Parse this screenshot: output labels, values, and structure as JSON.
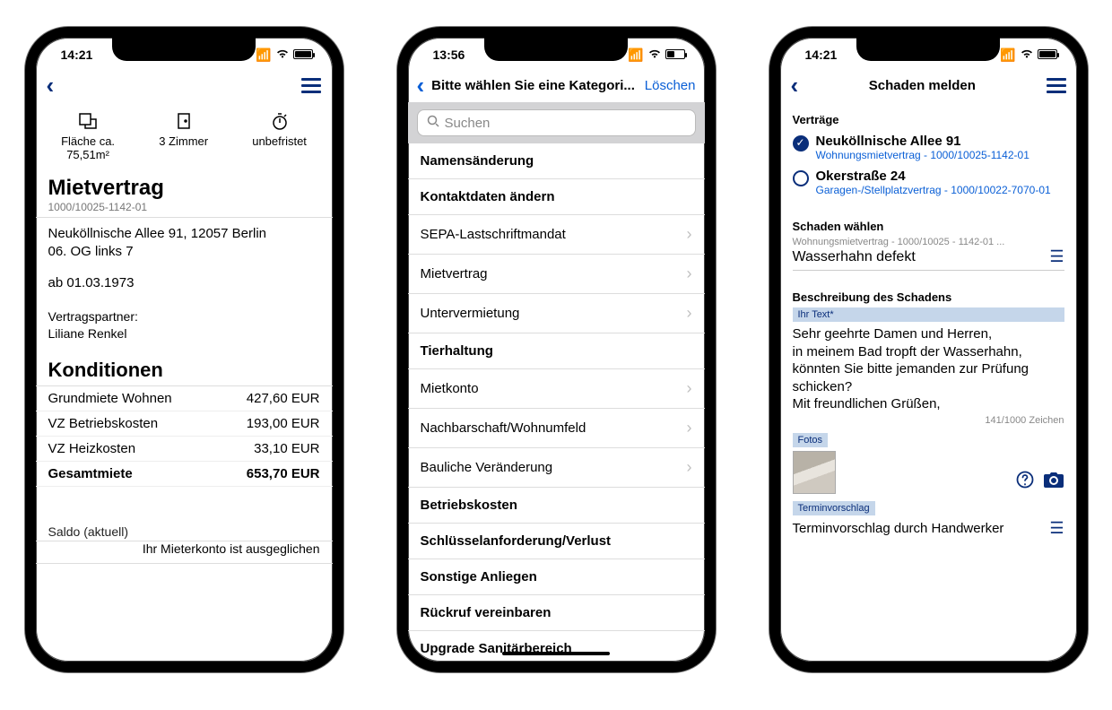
{
  "phone1": {
    "time": "14:21",
    "metrics": {
      "area_label": "Fläche ca.",
      "area_value": "75,51m²",
      "rooms_label": "3 Zimmer",
      "term_label": "unbefristet"
    },
    "title": "Mietvertrag",
    "contract_id": "1000/10025-1142-01",
    "address_line1": "Neuköllnische Allee 91, 12057 Berlin",
    "address_line2": "06. OG links 7",
    "start_date": "ab 01.03.1973",
    "partner_label": "Vertragspartner:",
    "partner_name": "Liliane Renkel",
    "conditions_title": "Konditionen",
    "cond": [
      {
        "label": "Grundmiete Wohnen",
        "value": "427,60 EUR"
      },
      {
        "label": "VZ Betriebskosten",
        "value": "193,00 EUR"
      },
      {
        "label": "VZ Heizkosten",
        "value": "33,10 EUR"
      },
      {
        "label": "Gesamtmiete",
        "value": "653,70 EUR"
      }
    ],
    "saldo_label": "Saldo (aktuell)",
    "saldo_msg": "Ihr Mieterkonto ist ausgeglichen"
  },
  "phone2": {
    "time": "13:56",
    "nav_title": "Bitte wählen Sie eine Kategori...",
    "delete": "Löschen",
    "search_placeholder": "Suchen",
    "categories": [
      {
        "label": "Namensänderung",
        "bold": true,
        "chev": false
      },
      {
        "label": "Kontaktdaten ändern",
        "bold": true,
        "chev": false
      },
      {
        "label": "SEPA-Lastschriftmandat",
        "bold": false,
        "chev": true
      },
      {
        "label": "Mietvertrag",
        "bold": false,
        "chev": true
      },
      {
        "label": "Untervermietung",
        "bold": false,
        "chev": true
      },
      {
        "label": "Tierhaltung",
        "bold": true,
        "chev": false
      },
      {
        "label": "Mietkonto",
        "bold": false,
        "chev": true
      },
      {
        "label": "Nachbarschaft/Wohnumfeld",
        "bold": false,
        "chev": true
      },
      {
        "label": "Bauliche Veränderung",
        "bold": false,
        "chev": true
      },
      {
        "label": "Betriebskosten",
        "bold": true,
        "chev": false
      },
      {
        "label": "Schlüsselanforderung/Verlust",
        "bold": true,
        "chev": false
      },
      {
        "label": "Sonstige Anliegen",
        "bold": true,
        "chev": false
      },
      {
        "label": "Rückruf vereinbaren",
        "bold": true,
        "chev": false
      },
      {
        "label": "Upgrade Sanitärbereich",
        "bold": true,
        "chev": false
      }
    ]
  },
  "phone3": {
    "time": "14:21",
    "nav_title": "Schaden melden",
    "contracts_label": "Verträge",
    "contracts": [
      {
        "title": "Neuköllnische Allee 91",
        "sub": "Wohnungsmietvertrag - 1000/10025-1142-01",
        "checked": true
      },
      {
        "title": "Okerstraße 24",
        "sub": "Garagen-/Stellplatzvertrag - 1000/10022-7070-01",
        "checked": false
      }
    ],
    "damage_select_label": "Schaden wählen",
    "damage_top": "Wohnungsmietvertrag - 1000/10025 - 1142-01 ...",
    "damage_name": "Wasserhahn defekt",
    "desc_label": "Beschreibung des Schadens",
    "text_field_label": "Ihr Text*",
    "message": "Sehr geehrte Damen und Herren,\nin meinem Bad tropft der Wasserhahn, könnten Sie bitte jemanden zur Prüfung schicken?\nMit freundlichen Grüßen,",
    "counter": "141/1000 Zeichen",
    "photos_label": "Fotos",
    "appointment_label": "Terminvorschlag",
    "appointment_value": "Terminvorschlag durch Handwerker"
  }
}
